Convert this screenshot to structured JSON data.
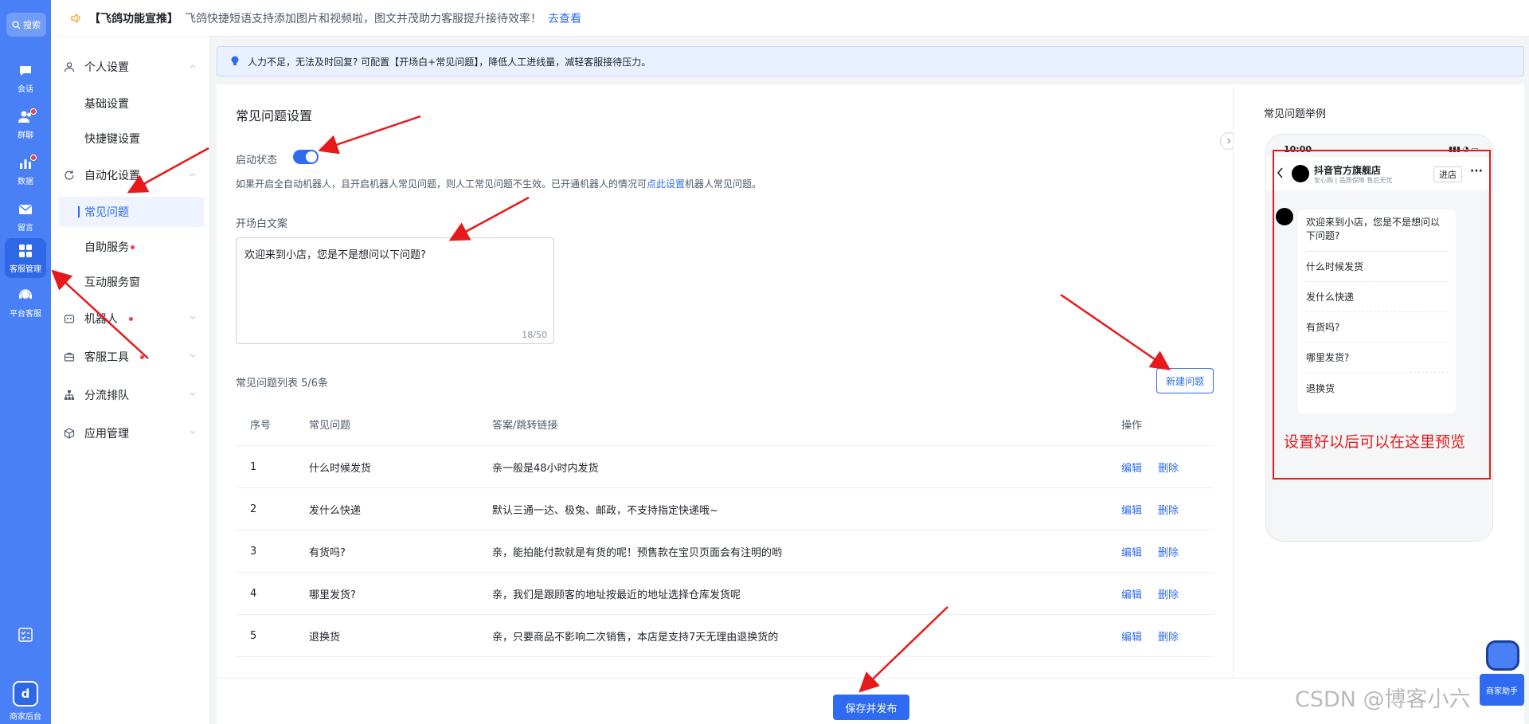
{
  "rail": {
    "search": "搜索",
    "items": [
      "会话",
      "群聊",
      "数据",
      "留言",
      "客服管理",
      "平台客服"
    ],
    "bottom": "商家后台",
    "logo": "d"
  },
  "topbar": {
    "tag": "【飞鸽功能宣推】",
    "message": "飞鸽快捷短语支持添加图片和视频啦，图文并茂助力客服提升接待效率！",
    "link": "去查看"
  },
  "subnav": {
    "personal": "个人设置",
    "basic": "基础设置",
    "shortcut": "快捷键设置",
    "automation": "自动化设置",
    "faq": "常见问题",
    "selfservice": "自助服务",
    "interactive": "互动服务窗",
    "robot": "机器人",
    "tools": "客服工具",
    "queue": "分流排队",
    "apps": "应用管理"
  },
  "banner": "人力不足，无法及时回复? 可配置【开场白+常见问题】，降低人工进线量，减轻客服接待压力。",
  "main": {
    "title": "常见问题设置",
    "status_label": "启动状态",
    "hint_pre": "如果开启全自动机器人，且开启机器人常见问题，则人工常见问题不生效。已开通机器人的情况可",
    "hint_link": "点此设置",
    "hint_post": "机器人常见问题。",
    "opening_label": "开场白文案",
    "opening_text": "欢迎来到小店，您是不是想问以下问题?",
    "counter": "18/50",
    "list_title": "常见问题列表 5/6条",
    "new_button": "新建问题",
    "columns": [
      "序号",
      "常见问题",
      "答案/跳转链接",
      "操作"
    ],
    "rows": [
      {
        "no": "1",
        "q": "什么时候发货",
        "a": "亲一般是48小时内发货"
      },
      {
        "no": "2",
        "q": "发什么快递",
        "a": "默认三通一达、极兔、邮政，不支持指定快递哦~"
      },
      {
        "no": "3",
        "q": "有货吗?",
        "a": "亲，能拍能付款就是有货的呢！预售款在宝贝页面会有注明的哟"
      },
      {
        "no": "4",
        "q": "哪里发货?",
        "a": "亲，我们是跟顾客的地址按最近的地址选择仓库发货呢"
      },
      {
        "no": "5",
        "q": "退换货",
        "a": "亲，只要商品不影响二次销售，本店是支持7天无理由退换货的"
      }
    ],
    "edit": "编辑",
    "delete": "删除",
    "save_button": "保存并发布"
  },
  "preview": {
    "title": "常见问题举例",
    "time": "10:00",
    "shop_name": "抖音官方旗舰店",
    "shop_sub": "安心购 | 品质保障 售后无忧",
    "enter": "进店",
    "greeting": "欢迎来到小店，您是不是想问以下问题?",
    "questions": [
      "什么时候发货",
      "发什么快递",
      "有货吗?",
      "哪里发货?",
      "退换货"
    ],
    "annotation": "设置好以后可以在这里预览"
  },
  "assistant_label": "商家助手",
  "watermark": "CSDN @博客小六"
}
